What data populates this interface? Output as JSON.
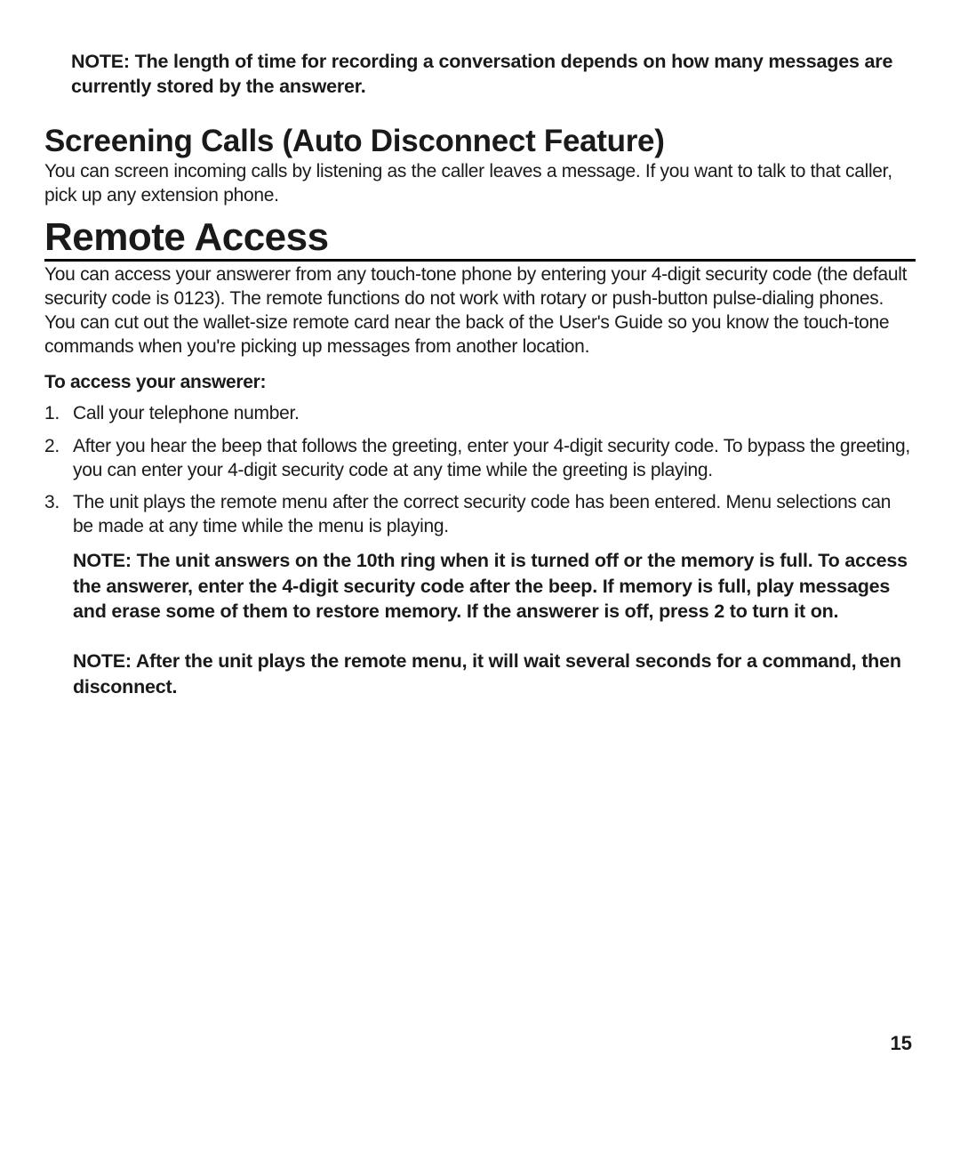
{
  "note_top": "NOTE: The length of time for recording a conversation depends on how many messages are currently stored by the answerer.",
  "screening": {
    "heading": "Screening Calls (Auto Disconnect Feature)",
    "body": "You can screen incoming calls by listening as the caller leaves a message. If you want to talk to that caller, pick up any extension phone."
  },
  "remote": {
    "heading": "Remote Access",
    "body": "You can access your answerer from any touch-tone phone by entering your 4-digit security code (the default security code is 0123). The remote functions do not work with rotary or push-button pulse-dialing phones. You can cut out the wallet-size remote card near the back of the User's Guide  so you know the touch-tone commands when you're picking up messages from another location.",
    "subhead": "To access your answerer:",
    "steps": [
      "Call your telephone number.",
      "After you hear the beep that follows the greeting, enter your 4-digit security code. To bypass the greeting, you can enter your 4-digit security code at any time while the greeting is playing.",
      "The unit plays the remote menu after the correct security code has been entered. Menu selections can be made at any time while the menu is playing."
    ],
    "note_memory": "NOTE: The unit answers on the 10th ring when it is turned off or the memory is full. To access the answerer, enter the 4-digit security code after the beep. If memory is full, play messages and erase some of them to restore memory. If the answerer is off, press 2 to turn it on.",
    "note_wait": "NOTE: After the unit plays the remote menu, it will wait several seconds for a command, then disconnect."
  },
  "page_number": "15"
}
